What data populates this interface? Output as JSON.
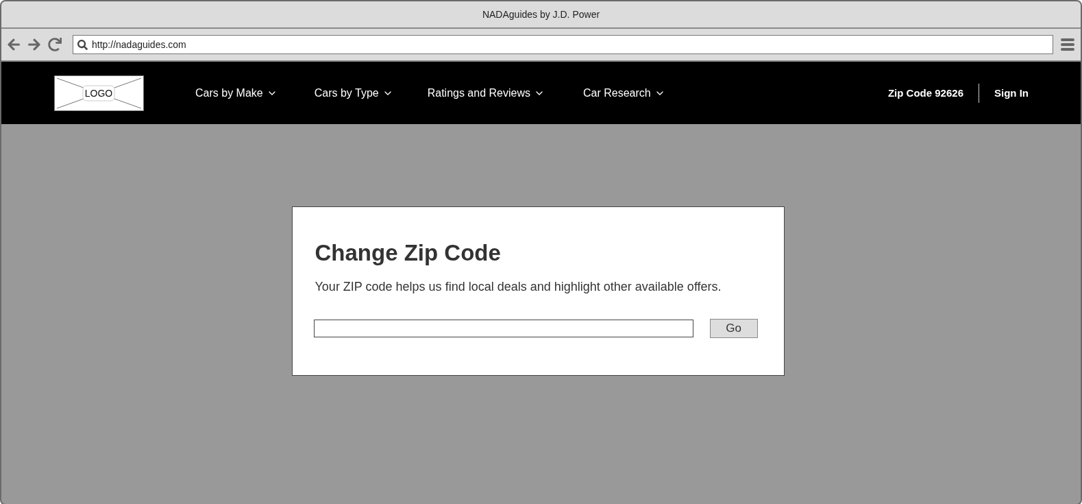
{
  "window": {
    "title": "NADAguides by J.D. Power"
  },
  "address_bar": {
    "url": "http://nadaguides.com"
  },
  "header": {
    "logo": "LOGO",
    "nav": [
      {
        "label": "Cars by Make"
      },
      {
        "label": "Cars by Type"
      },
      {
        "label": "Ratings and Reviews"
      },
      {
        "label": "Car Research"
      }
    ],
    "zip_code": "Zip Code 92626",
    "sign_in": "Sign In"
  },
  "dialog": {
    "title": "Change Zip Code",
    "text": "Your ZIP code helps us find local deals and highlight other available offers.",
    "button": "Go"
  }
}
